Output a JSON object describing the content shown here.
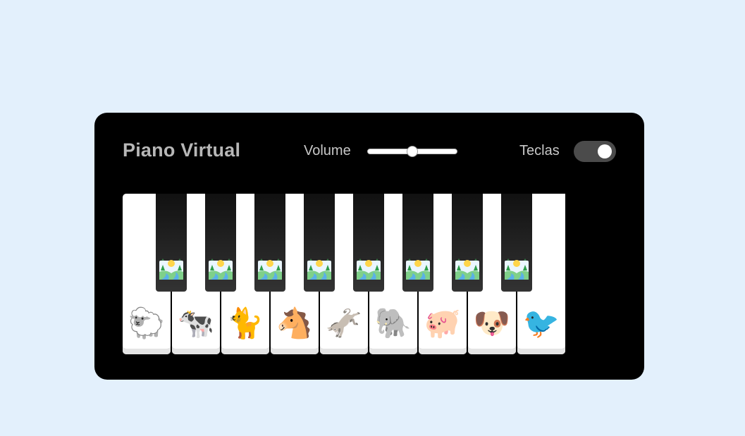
{
  "header": {
    "title": "Piano Virtual",
    "volume_label": "Volume",
    "keys_label": "Teclas"
  },
  "volume": {
    "value": 0.5
  },
  "keys_toggle": {
    "on": true
  },
  "white_keys": [
    {
      "animal": "sheep",
      "icon": "🐑"
    },
    {
      "animal": "cow",
      "icon": "🐄"
    },
    {
      "animal": "cat",
      "icon": "🐈"
    },
    {
      "animal": "horse",
      "icon": "🐴"
    },
    {
      "animal": "donkey",
      "icon": "🫏"
    },
    {
      "animal": "elephant",
      "icon": "🐘"
    },
    {
      "animal": "pig",
      "icon": "🐖"
    },
    {
      "animal": "dog",
      "icon": "🐶"
    },
    {
      "animal": "bird",
      "icon": "🐦"
    }
  ],
  "black_keys": [
    {
      "icon": "landscape-icon"
    },
    {
      "icon": "landscape-icon"
    },
    {
      "icon": "landscape-icon"
    },
    {
      "icon": "landscape-icon"
    },
    {
      "icon": "landscape-icon"
    },
    {
      "icon": "landscape-icon"
    },
    {
      "icon": "landscape-icon"
    },
    {
      "icon": "landscape-icon"
    }
  ],
  "colors": {
    "background": "#e3f0fc",
    "panel": "#000000",
    "toggle_bg": "#4b4b4b"
  }
}
